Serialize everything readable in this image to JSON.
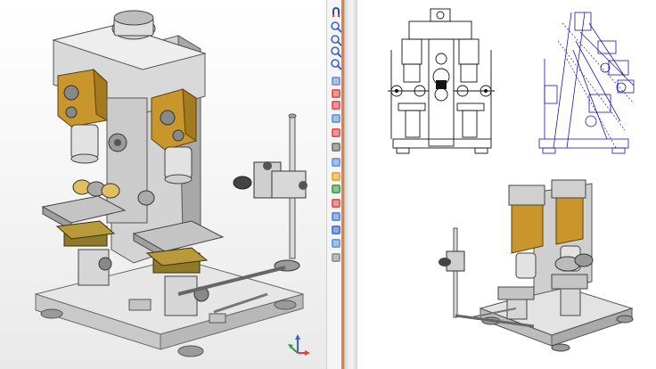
{
  "app": {
    "accent": "#f07a3a",
    "bg_left": "#f0f0f0",
    "bg_right": "#ffffff"
  },
  "toolbar": {
    "tools": [
      {
        "name": "magnet-icon",
        "color": "#2a4fbd"
      },
      {
        "name": "zoom-in-icon",
        "color": "#3a64c8"
      },
      {
        "name": "zoom-out-icon",
        "color": "#3a64c8"
      },
      {
        "name": "zoom-window-icon",
        "color": "#3a64c8"
      },
      {
        "name": "zoom-fit-icon",
        "color": "#3a64c8"
      },
      {
        "name": "view-front-icon",
        "color": "#6b8ad6"
      },
      {
        "name": "section-view-icon",
        "color": "#d84444"
      },
      {
        "name": "checkmark-icon",
        "color": "#d84444"
      },
      {
        "name": "shaded-icon",
        "color": "#5b8ed8"
      },
      {
        "name": "measure-icon",
        "color": "#d84444"
      },
      {
        "name": "view-orient-icon",
        "color": "#6a6a6a"
      },
      {
        "name": "display-style-icon",
        "color": "#5b8ed8"
      },
      {
        "name": "appearance-icon",
        "color": "#e0a020"
      },
      {
        "name": "scene-icon",
        "color": "#2f9a3a"
      },
      {
        "name": "render-icon",
        "color": "#d84444"
      },
      {
        "name": "hide-show-icon",
        "color": "#4a7fd0"
      },
      {
        "name": "walkthrough-icon",
        "color": "#3a64c8"
      },
      {
        "name": "camera-icon",
        "color": "#5b8ed8"
      },
      {
        "name": "lighting-icon",
        "color": "#8a8a8a"
      }
    ]
  },
  "triad": {
    "x_label": "",
    "y_label": "",
    "z_label": ""
  }
}
